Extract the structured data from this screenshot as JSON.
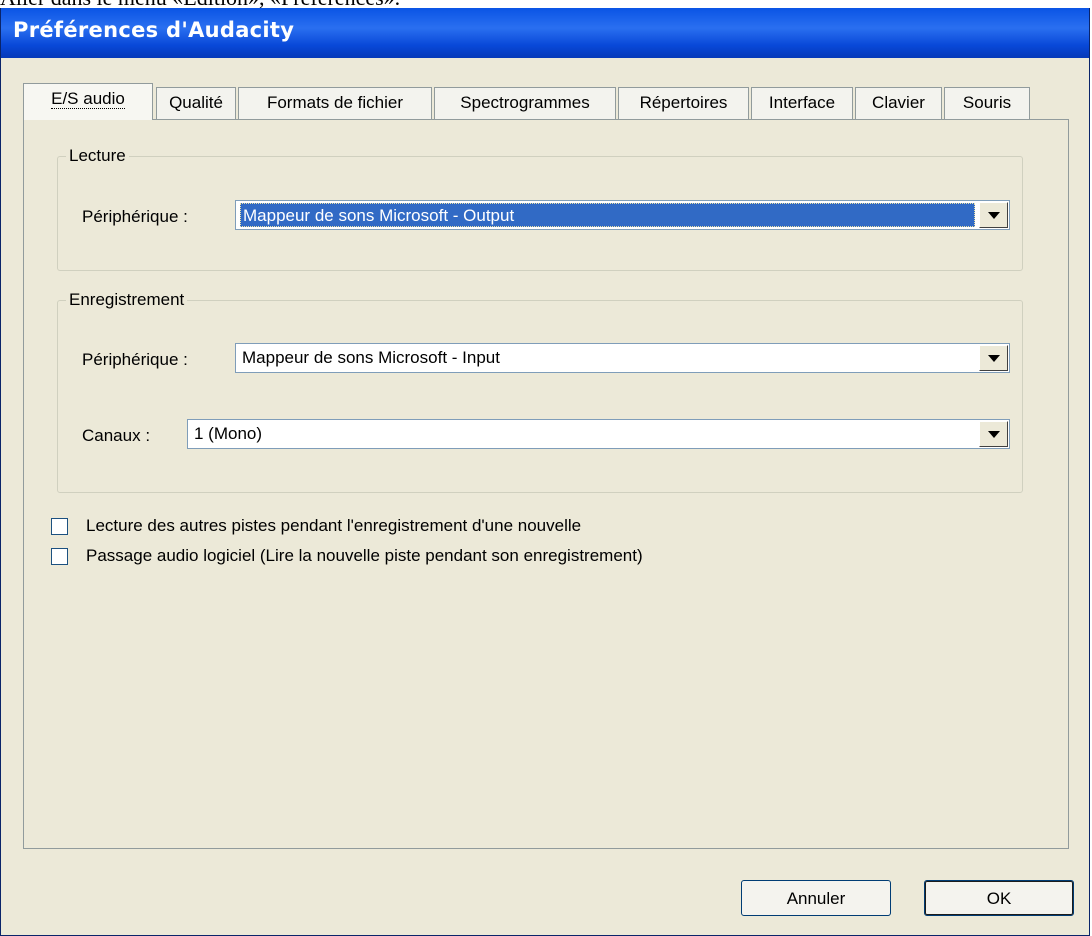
{
  "caption": "Aller dans le menu «Edition», «Préférences».",
  "window": {
    "title": "Préférences d'Audacity"
  },
  "tabs": [
    {
      "label": "E/S audio",
      "active": true
    },
    {
      "label": "Qualité",
      "active": false
    },
    {
      "label": "Formats de fichier",
      "active": false
    },
    {
      "label": "Spectrogrammes",
      "active": false
    },
    {
      "label": "Répertoires",
      "active": false
    },
    {
      "label": "Interface",
      "active": false
    },
    {
      "label": "Clavier",
      "active": false
    },
    {
      "label": "Souris",
      "active": false
    }
  ],
  "playback": {
    "legend": "Lecture",
    "device_label": "Périphérique :",
    "device_value": "Mappeur de sons Microsoft - Output"
  },
  "recording": {
    "legend": "Enregistrement",
    "device_label": "Périphérique :",
    "device_value": "Mappeur de sons Microsoft - Input",
    "channels_label": "Canaux :",
    "channels_value": "1 (Mono)"
  },
  "options": [
    {
      "label": "Lecture des autres pistes pendant l'enregistrement d'une nouvelle",
      "checked": false
    },
    {
      "label": "Passage audio logiciel (Lire la nouvelle piste pendant son enregistrement)",
      "checked": false
    }
  ],
  "buttons": {
    "cancel": "Annuler",
    "ok": "OK"
  }
}
